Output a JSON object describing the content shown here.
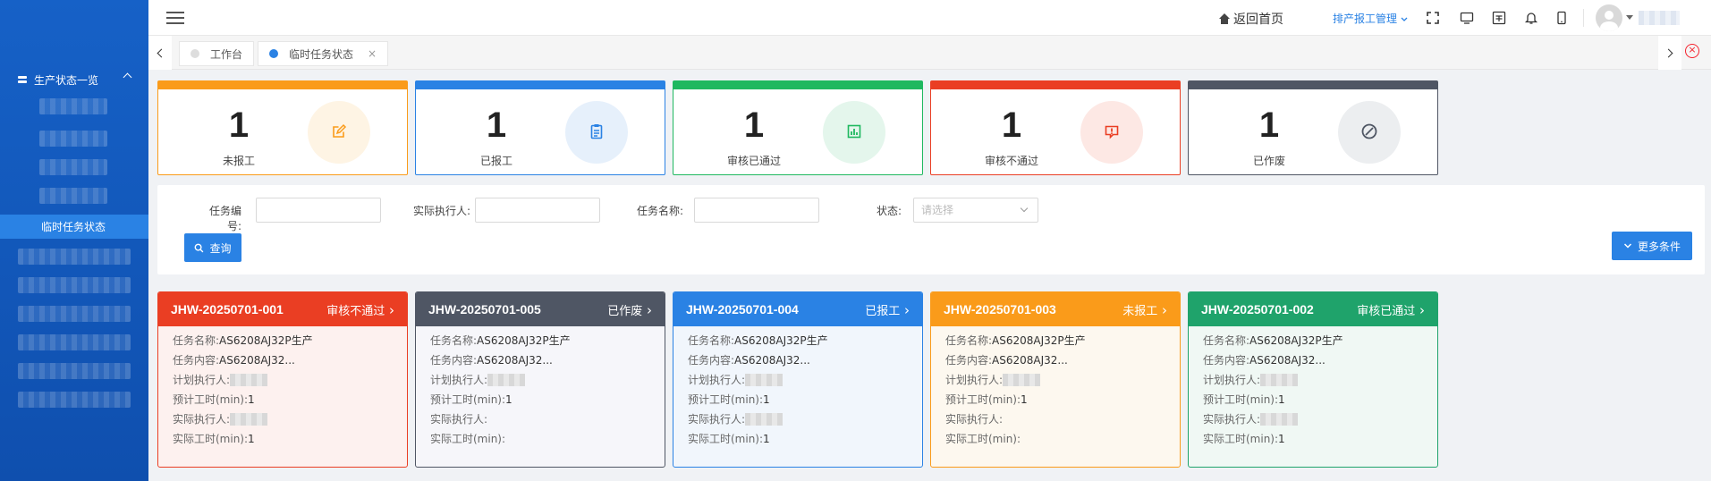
{
  "topbar": {
    "home_label": "返回首页",
    "menu_label": "排产报工管理",
    "icons": [
      "fullscreen-icon",
      "monitor-icon",
      "layout-icon",
      "bell-icon",
      "mobile-icon"
    ]
  },
  "sidebar": {
    "group_label": "生产状态一览",
    "active_label": "临时任务状态"
  },
  "tabs": [
    {
      "label": "工作台"
    },
    {
      "label": "临时任务状态",
      "close": "×"
    }
  ],
  "closeall_glyph": "×",
  "stats": [
    {
      "num": "1",
      "label": "未报工",
      "color": "#fa9b1a",
      "bg": "#fef4e4",
      "icon": "edit-icon"
    },
    {
      "num": "1",
      "label": "已报工",
      "color": "#2a82e4",
      "bg": "#e6f0fb",
      "icon": "clipboard-icon"
    },
    {
      "num": "1",
      "label": "审核已通过",
      "color": "#1fb85f",
      "bg": "#e4f6ec",
      "icon": "chart-icon"
    },
    {
      "num": "1",
      "label": "审核不通过",
      "color": "#ea3e23",
      "bg": "#fde8e4",
      "icon": "alert-icon"
    },
    {
      "num": "1",
      "label": "已作废",
      "color": "#4f5664",
      "bg": "#eceef0",
      "icon": "ban-icon"
    }
  ],
  "filter": {
    "task_no_label": "任务编号:",
    "executor_label": "实际执行人:",
    "task_name_label": "任务名称:",
    "status_label": "状态:",
    "status_placeholder": "请选择",
    "query_label": "查询",
    "more_label": "更多条件"
  },
  "cards": [
    {
      "id": "JHW-20250701-001",
      "status": "审核不通过",
      "color": "#ea3e23",
      "bg": "#fdf1ef",
      "fields": [
        {
          "k": "任务名称:",
          "v": "AS6208AJ32P生产"
        },
        {
          "k": "任务内容:",
          "v": "AS6208AJ32..."
        },
        {
          "k": "计划执行人:",
          "v": "",
          "blur": true
        },
        {
          "k": "预计工时(min):",
          "v": "1"
        },
        {
          "k": "实际执行人:",
          "v": "",
          "blur": true
        },
        {
          "k": "实际工时(min):",
          "v": "1"
        }
      ]
    },
    {
      "id": "JHW-20250701-005",
      "status": "已作废",
      "color": "#4f5664",
      "bg": "#f6f6fa",
      "fields": [
        {
          "k": "任务名称:",
          "v": "AS6208AJ32P生产"
        },
        {
          "k": "任务内容:",
          "v": "AS6208AJ32..."
        },
        {
          "k": "计划执行人:",
          "v": "",
          "blur": true
        },
        {
          "k": "预计工时(min):",
          "v": "1"
        },
        {
          "k": "实际执行人:",
          "v": ""
        },
        {
          "k": "实际工时(min):",
          "v": ""
        }
      ]
    },
    {
      "id": "JHW-20250701-004",
      "status": "已报工",
      "color": "#2a82e4",
      "bg": "#f1f6fc",
      "fields": [
        {
          "k": "任务名称:",
          "v": "AS6208AJ32P生产"
        },
        {
          "k": "任务内容:",
          "v": "AS6208AJ32..."
        },
        {
          "k": "计划执行人:",
          "v": "",
          "blur": true
        },
        {
          "k": "预计工时(min):",
          "v": "1"
        },
        {
          "k": "实际执行人:",
          "v": "",
          "blur": true
        },
        {
          "k": "实际工时(min):",
          "v": "1"
        }
      ]
    },
    {
      "id": "JHW-20250701-003",
      "status": "未报工",
      "color": "#fa9b1a",
      "bg": "#fdf8ef",
      "fields": [
        {
          "k": "任务名称:",
          "v": "AS6208AJ32P生产"
        },
        {
          "k": "任务内容:",
          "v": "AS6208AJ32..."
        },
        {
          "k": "计划执行人:",
          "v": "",
          "blur": true
        },
        {
          "k": "预计工时(min):",
          "v": "1"
        },
        {
          "k": "实际执行人:",
          "v": ""
        },
        {
          "k": "实际工时(min):",
          "v": ""
        }
      ]
    },
    {
      "id": "JHW-20250701-002",
      "status": "审核已通过",
      "color": "#1fa36b",
      "bg": "#f0f8f4",
      "fields": [
        {
          "k": "任务名称:",
          "v": "AS6208AJ32P生产"
        },
        {
          "k": "任务内容:",
          "v": "AS6208AJ32..."
        },
        {
          "k": "计划执行人:",
          "v": "",
          "blur": true
        },
        {
          "k": "预计工时(min):",
          "v": "1"
        },
        {
          "k": "实际执行人:",
          "v": "",
          "blur": true
        },
        {
          "k": "实际工时(min):",
          "v": "1"
        }
      ]
    }
  ]
}
